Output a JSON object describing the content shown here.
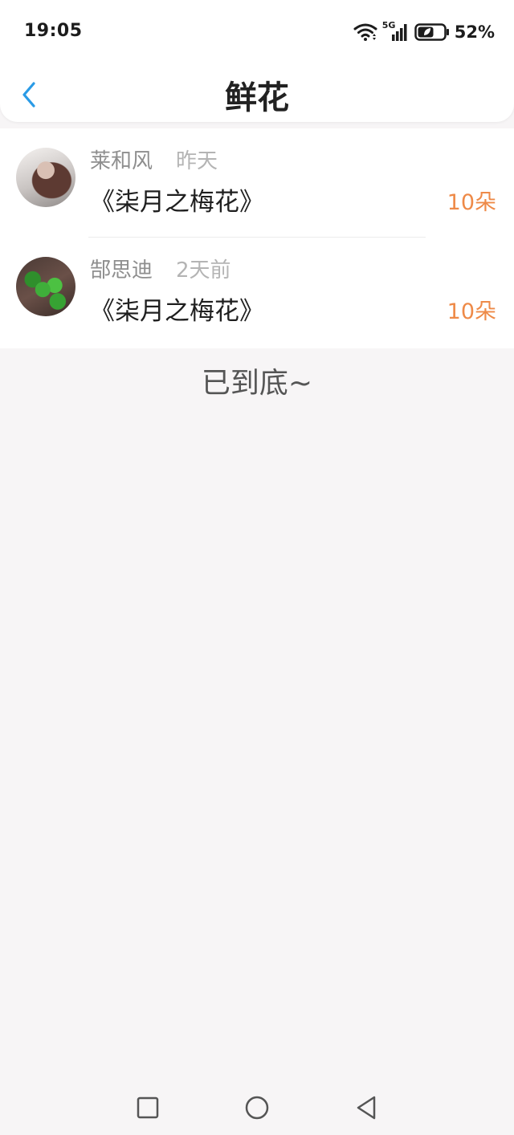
{
  "status_bar": {
    "time": "19:05",
    "network": "5G",
    "battery": "52%"
  },
  "header": {
    "title": "鲜花",
    "back_icon": "chevron-left-icon",
    "accent_color": "#2a9be6"
  },
  "records": [
    {
      "user": "莱和风",
      "time": "昨天",
      "gift": "《柒月之梅花》",
      "count": "10朵"
    },
    {
      "user": "郜思迪",
      "time": "2天前",
      "gift": "《柒月之梅花》",
      "count": "10朵"
    }
  ],
  "footer": {
    "end_text": "已到底~"
  },
  "colors": {
    "count": "#ee8a48",
    "background": "#f7f5f6"
  },
  "nav_bar": {
    "icons": [
      "square-icon",
      "circle-icon",
      "triangle-back-icon"
    ]
  }
}
